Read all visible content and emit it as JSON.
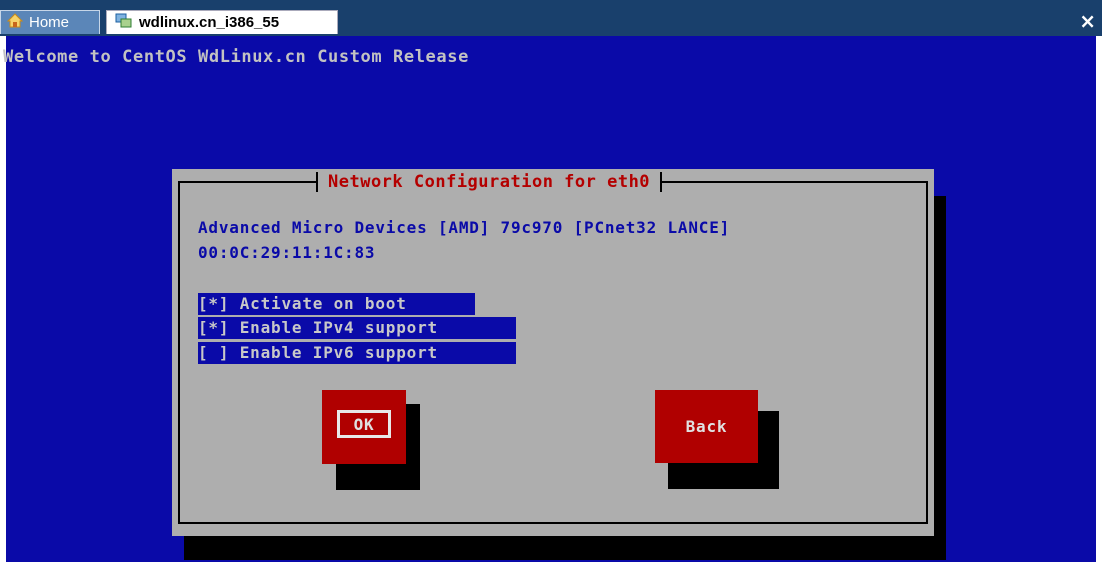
{
  "tabs": {
    "home_label": "Home",
    "vm_label": "wdlinux.cn_i386_55",
    "close_symbol": "×"
  },
  "console": {
    "welcome": "Welcome to CentOS WdLinux.cn Custom Release"
  },
  "dialog": {
    "title": "Network Configuration for eth0",
    "device_name": "Advanced Micro Devices [AMD] 79c970 [PCnet32 LANCE]",
    "mac_address": "00:0C:29:11:1C:83",
    "options": [
      {
        "label": "[*] Activate on boot",
        "checked": true
      },
      {
        "label": "[*] Enable IPv4 support",
        "checked": true
      },
      {
        "label": "[ ] Enable IPv6 support",
        "checked": false
      }
    ],
    "ok_label": "OK",
    "back_label": "Back"
  },
  "colors": {
    "console_bg": "#0a0aa8",
    "dialog_bg": "#aeaeae",
    "title_red": "#b40000",
    "button_red": "#b00000"
  },
  "icons": [
    "home-icon",
    "vm-icon",
    "close-icon"
  ]
}
